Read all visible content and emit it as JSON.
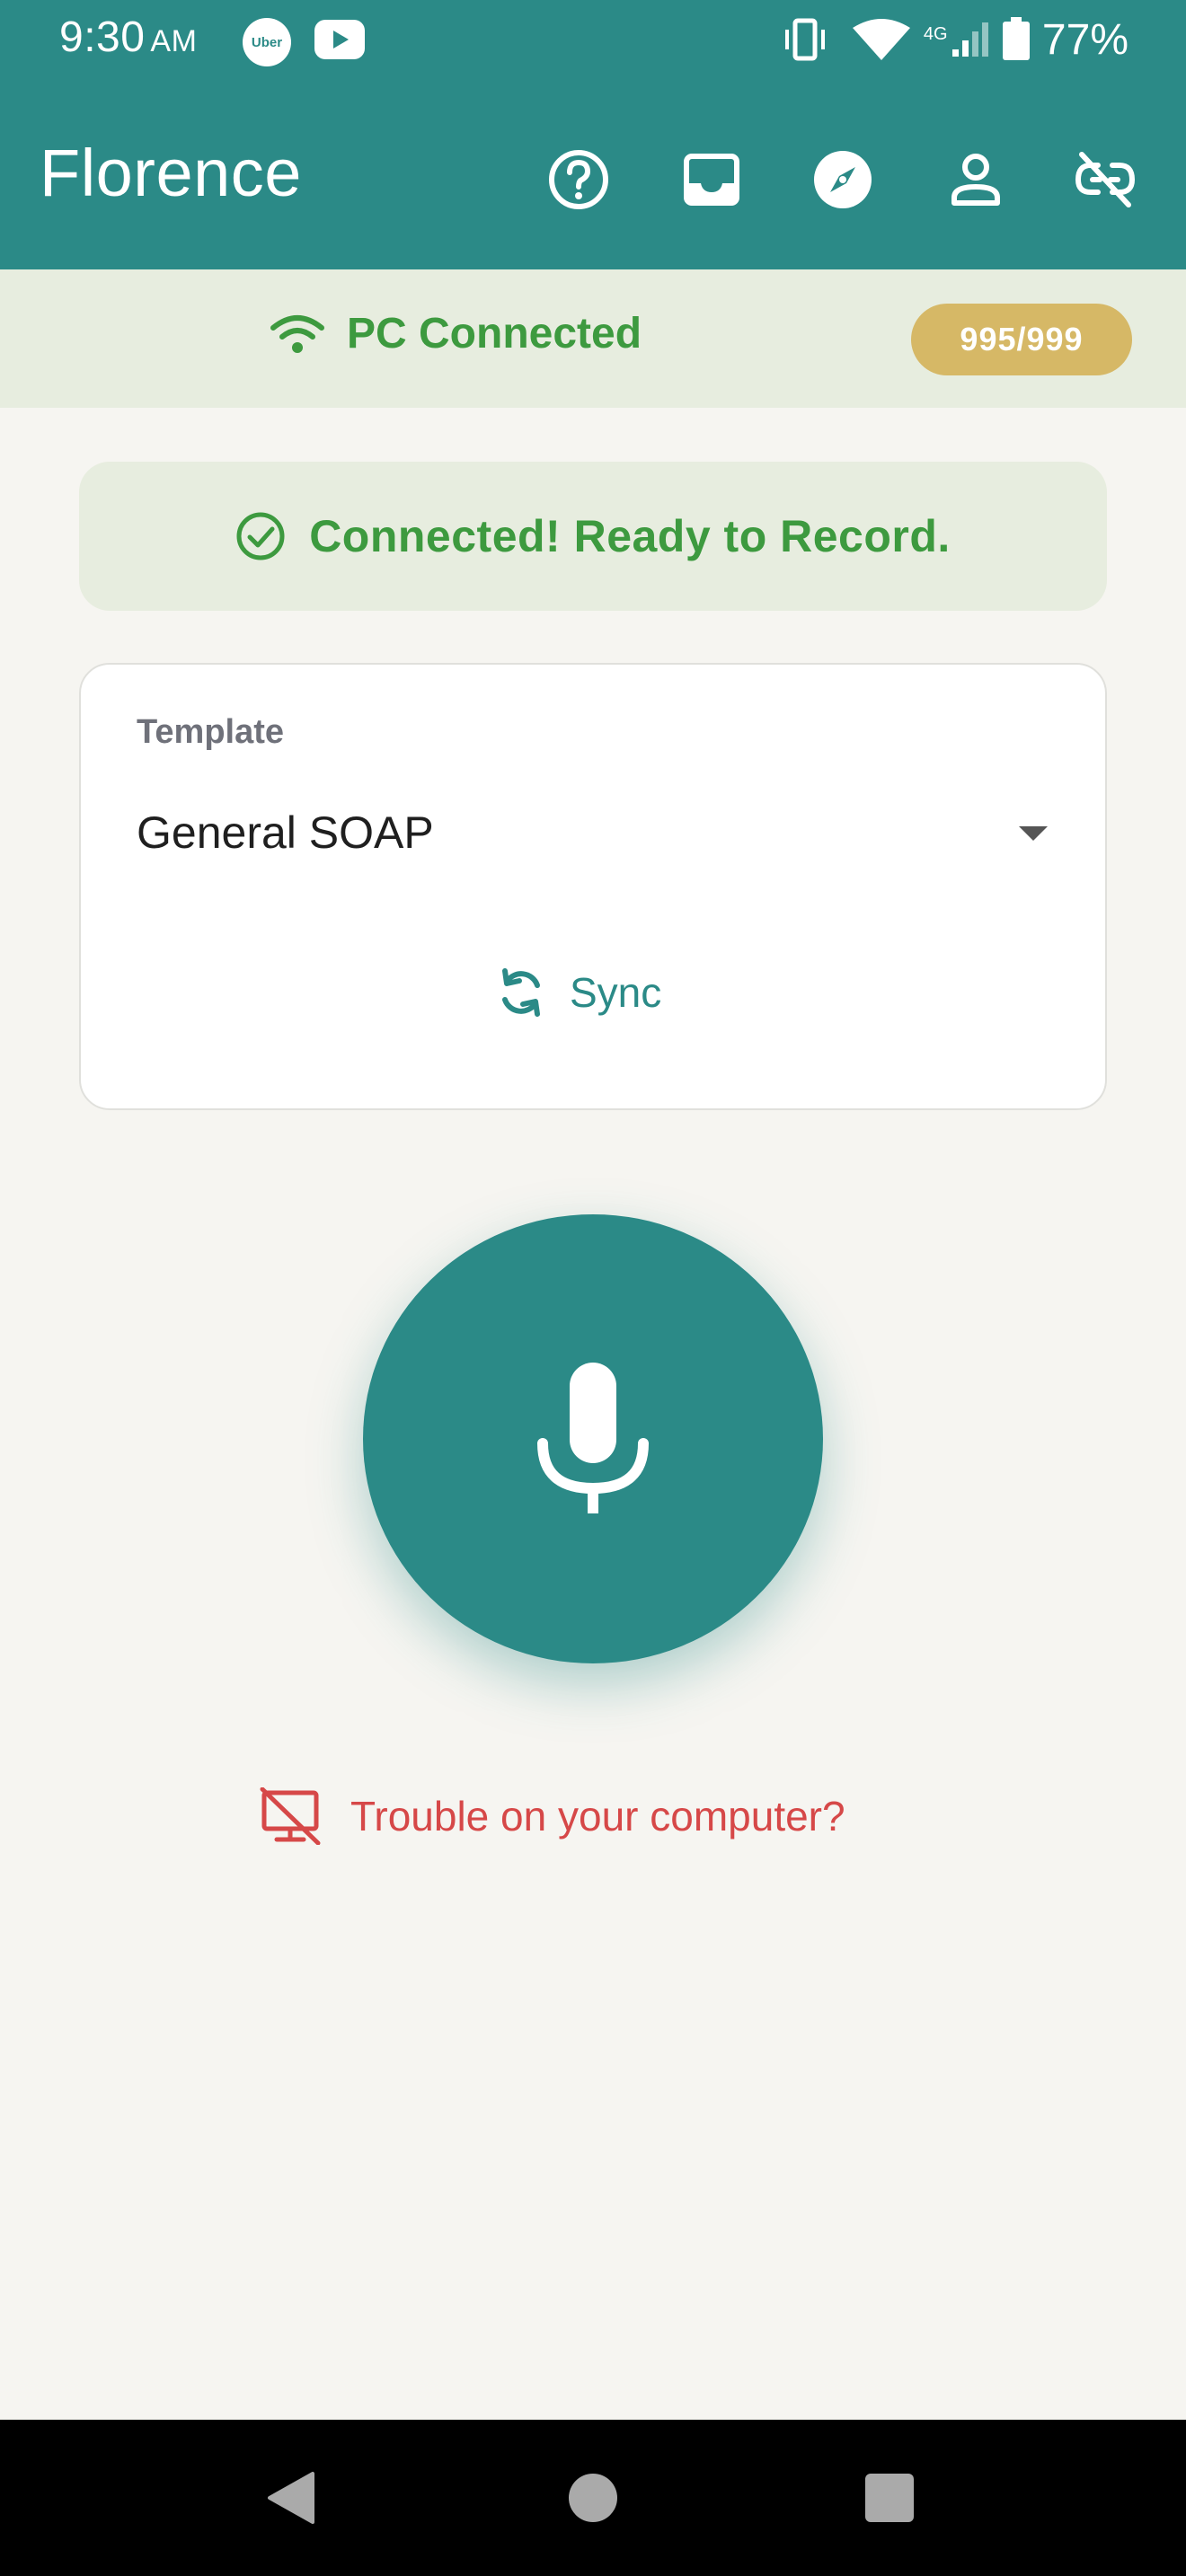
{
  "status_bar": {
    "time": "9:30",
    "ampm": "AM",
    "uber_label": "Uber",
    "battery": "77%",
    "network": "4G"
  },
  "header": {
    "title": "Florence"
  },
  "connection": {
    "status": "PC Connected",
    "usage": "995/999"
  },
  "ready_message": "Connected! Ready to Record.",
  "template": {
    "label": "Template",
    "selected": "General SOAP",
    "sync_label": "Sync"
  },
  "trouble_link": "Trouble on your computer?",
  "colors": {
    "primary": "#2b8a87",
    "success": "#3d9a3f",
    "banner_bg": "#e7eddf",
    "badge": "#d6b866",
    "danger": "#d64848"
  }
}
